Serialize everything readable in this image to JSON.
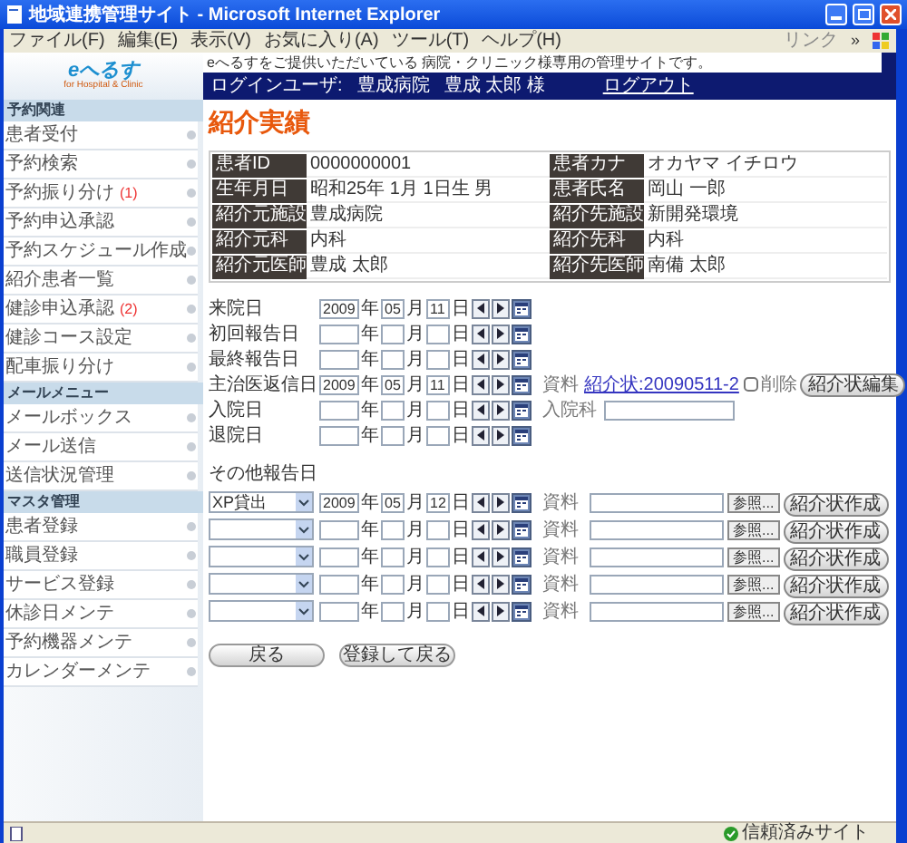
{
  "window": {
    "title": "地域連携管理サイト - Microsoft Internet Explorer",
    "menu": [
      "ファイル(F)",
      "編集(E)",
      "表示(V)",
      "お気に入り(A)",
      "ツール(T)",
      "ヘルプ(H)"
    ],
    "links_label": "リンク",
    "chevron": "»"
  },
  "header": {
    "logo": "eへるす",
    "logo_sub": "for Hospital & Clinic",
    "notice": "eへるすをご提供いただいている 病院・クリニック様専用の管理サイトです。",
    "login_label": "ログインユーザ:",
    "hospital": "豊成病院",
    "user": "豊成 太郎 様",
    "logout": "ログアウト"
  },
  "sidebar": [
    {
      "title": "予約関連",
      "items": [
        {
          "label": "患者受付"
        },
        {
          "label": "予約検索"
        },
        {
          "label": "予約振り分け",
          "badge": "(1)"
        },
        {
          "label": "予約申込承認"
        },
        {
          "label": "予約スケジュール作成"
        },
        {
          "label": "紹介患者一覧"
        },
        {
          "label": "健診申込承認",
          "badge": "(2)"
        },
        {
          "label": "健診コース設定"
        },
        {
          "label": "配車振り分け"
        }
      ]
    },
    {
      "title": "メールメニュー",
      "items": [
        {
          "label": "メールボックス"
        },
        {
          "label": "メール送信"
        },
        {
          "label": "送信状況管理"
        }
      ]
    },
    {
      "title": "マスタ管理",
      "items": [
        {
          "label": "患者登録"
        },
        {
          "label": "職員登録"
        },
        {
          "label": "サービス登録"
        },
        {
          "label": "休診日メンテ"
        },
        {
          "label": "予約機器メンテ"
        },
        {
          "label": "カレンダーメンテ"
        }
      ]
    }
  ],
  "main": {
    "title": "紹介実績",
    "info": [
      {
        "label": "患者ID",
        "value": "0000000001"
      },
      {
        "label": "患者カナ",
        "value": "オカヤマ イチロウ"
      },
      {
        "label": "生年月日",
        "value": "昭和25年 1月 1日生  男"
      },
      {
        "label": "患者氏名",
        "value": "岡山 一郎"
      },
      {
        "label": "紹介元施設",
        "value": "豊成病院"
      },
      {
        "label": "紹介先施設",
        "value": "新開発環境"
      },
      {
        "label": "紹介元科",
        "value": "内科"
      },
      {
        "label": "紹介先科",
        "value": "内科"
      },
      {
        "label": "紹介元医師",
        "value": "豊成 太郎"
      },
      {
        "label": "紹介先医師",
        "value": "南備 太郎"
      }
    ],
    "dates": [
      {
        "kind": "plain",
        "label": "来院日",
        "year": "2009",
        "month": "05",
        "day": "11",
        "units": [
          "年",
          "月",
          "日"
        ]
      },
      {
        "kind": "plain",
        "label": "初回報告日",
        "units": [
          "年",
          "月",
          "日"
        ]
      },
      {
        "kind": "plain",
        "label": "最終報告日",
        "units": [
          "年",
          "月",
          "日"
        ]
      },
      {
        "kind": "document",
        "label": "主治医返信日",
        "year": "2009",
        "month": "05",
        "day": "11",
        "units": [
          "年",
          "月",
          "日"
        ],
        "doc_label": "資料",
        "link": "紹介状:20090511-2",
        "delete_label": "削除",
        "delete_checked": false,
        "edit_button": "紹介状編集"
      },
      {
        "kind": "department",
        "label": "入院日",
        "units": [
          "年",
          "月",
          "日"
        ],
        "dept_label": "入院科"
      },
      {
        "kind": "plain",
        "label": "退院日",
        "units": [
          "年",
          "月",
          "日"
        ]
      }
    ],
    "other_title": "その他報告日",
    "others": [
      {
        "type": "XP貸出",
        "year": "2009",
        "month": "05",
        "day": "12",
        "units": [
          "年",
          "月",
          "日"
        ],
        "doc_label": "資料",
        "browse": "参照...",
        "create": "紹介状作成"
      },
      {
        "units": [
          "年",
          "月",
          "日"
        ],
        "doc_label": "資料",
        "browse": "参照...",
        "create": "紹介状作成"
      },
      {
        "units": [
          "年",
          "月",
          "日"
        ],
        "doc_label": "資料",
        "browse": "参照...",
        "create": "紹介状作成"
      },
      {
        "units": [
          "年",
          "月",
          "日"
        ],
        "doc_label": "資料",
        "browse": "参照...",
        "create": "紹介状作成"
      },
      {
        "units": [
          "年",
          "月",
          "日"
        ],
        "doc_label": "資料",
        "browse": "参照...",
        "create": "紹介状作成"
      }
    ],
    "buttons": [
      "戻る",
      "登録して戻る"
    ]
  },
  "status_bar": {
    "zone": "信頼済みサイト"
  }
}
